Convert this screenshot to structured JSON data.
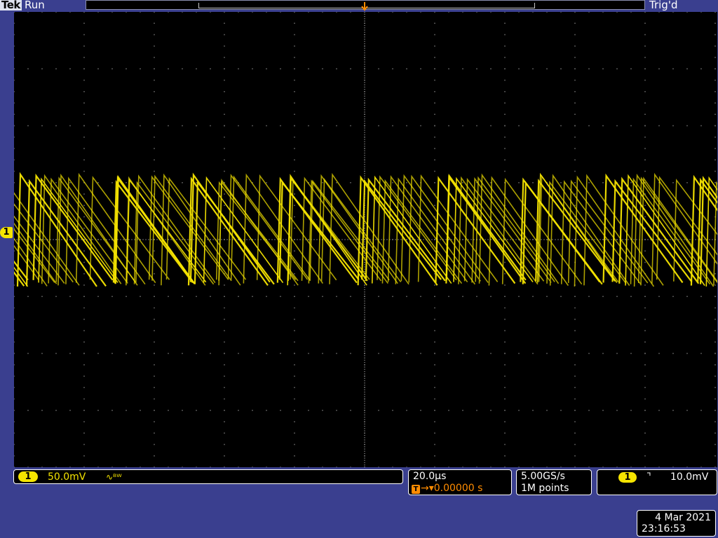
{
  "header": {
    "brand": "Tek",
    "acq_status": "Run",
    "trigger_status": "Trig'd"
  },
  "trigger_position_marker": "T",
  "channel_marker": "1",
  "vertical": {
    "channel": "1",
    "scale": "50.0mV",
    "bandwidth_icon": "∿ᴮᵂ"
  },
  "horizontal": {
    "scale": "20.0µs",
    "trigger_icon": "T",
    "position": "→▾0.00000 s"
  },
  "acquisition": {
    "sample_rate": "5.00GS/s",
    "record_length": "1M points"
  },
  "trigger": {
    "source": "1",
    "slope_icon": "⌝",
    "level": "10.0mV"
  },
  "datetime": {
    "date": "4 Mar 2021",
    "time": "23:16:53"
  },
  "colors": {
    "trace": "#f5e400",
    "trigger_accent": "#ff8c00",
    "frame": "#3a3f8f",
    "screen": "#000000"
  }
}
